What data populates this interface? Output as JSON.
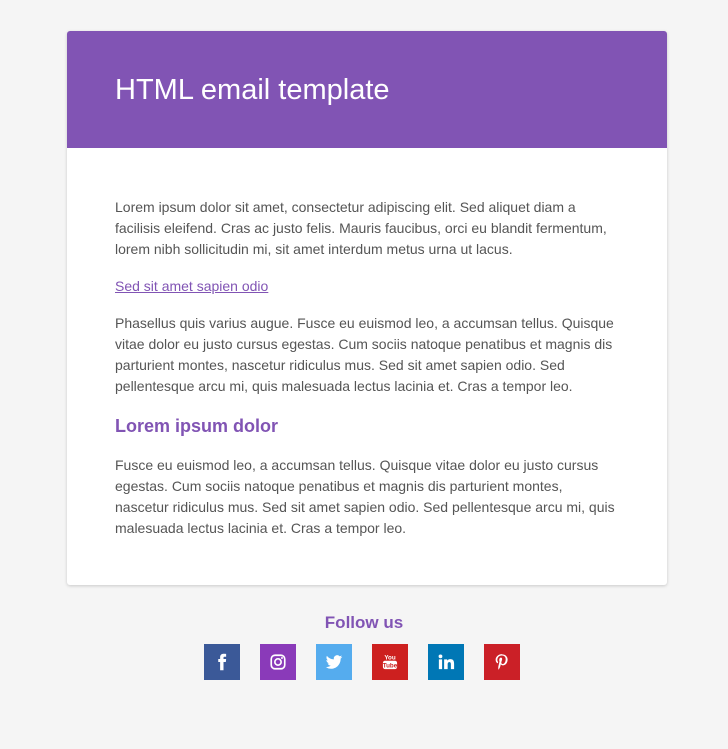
{
  "header": {
    "title": "HTML email template",
    "background": "#8154b4"
  },
  "content": {
    "paragraph_1": "Lorem ipsum dolor sit amet, consectetur adipiscing elit. Sed aliquet diam a facilisis eleifend. Cras ac justo felis. Mauris faucibus, orci eu blandit fermentum, lorem nibh sollicitudin mi, sit amet interdum metus urna ut lacus.",
    "link_text": "Sed sit amet sapien odio",
    "paragraph_2": "Phasellus quis varius augue. Fusce eu euismod leo, a accumsan tellus. Quisque vitae dolor eu justo cursus egestas. Cum sociis natoque penatibus et magnis dis parturient montes, nascetur ridiculus mus. Sed sit amet sapien odio. Sed pellentesque arcu mi, quis malesuada lectus lacinia et. Cras a tempor leo.",
    "section_heading": "Lorem ipsum dolor",
    "paragraph_3": "Fusce eu euismod leo, a accumsan tellus. Quisque vitae dolor eu justo cursus egestas. Cum sociis natoque penatibus et magnis dis parturient montes, nascetur ridiculus mus. Sed sit amet sapien odio. Sed pellentesque arcu mi, quis malesuada lectus lacinia et. Cras a tempor leo."
  },
  "footer": {
    "follow_title": "Follow us",
    "social": [
      {
        "name": "facebook-icon",
        "color": "#3b5998"
      },
      {
        "name": "instagram-icon",
        "color": "#8a3ab9"
      },
      {
        "name": "twitter-icon",
        "color": "#55acee"
      },
      {
        "name": "youtube-icon",
        "color": "#cd201f"
      },
      {
        "name": "linkedin-icon",
        "color": "#0077b5"
      },
      {
        "name": "pinterest-icon",
        "color": "#cb2027"
      }
    ]
  },
  "colors": {
    "accent": "#8154b4",
    "page_background": "#f5f5f5",
    "body_text": "#555555"
  }
}
